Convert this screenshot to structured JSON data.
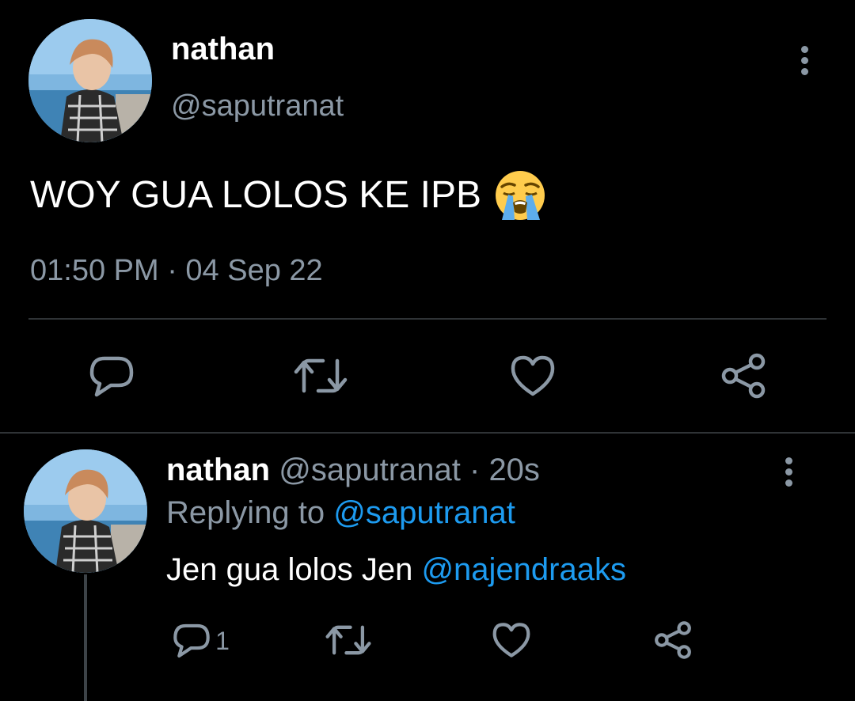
{
  "main_tweet": {
    "display_name": "nathan",
    "handle": "@saputranat",
    "text": "WOY GUA LOLOS KE IPB",
    "emoji": "loudly-crying-face",
    "timestamp": "01:50 PM · 04 Sep 22",
    "actions": [
      "reply-icon",
      "retweet-icon",
      "like-icon",
      "share-icon"
    ]
  },
  "reply_tweet": {
    "display_name": "nathan",
    "handle": "@saputranat",
    "separator": " · ",
    "time_ago": "20s",
    "replying_to_label": "Replying to",
    "replying_to_handle": "@saputranat",
    "text": "Jen gua lolos Jen",
    "mention": "@najendraaks",
    "reply_count": "1",
    "actions": [
      "reply-icon",
      "retweet-icon",
      "like-icon",
      "share-icon"
    ]
  },
  "colors": {
    "background": "#000000",
    "text": "#ffffff",
    "muted": "#8b98a5",
    "link": "#1d9bf0",
    "divider": "#2f3336"
  }
}
